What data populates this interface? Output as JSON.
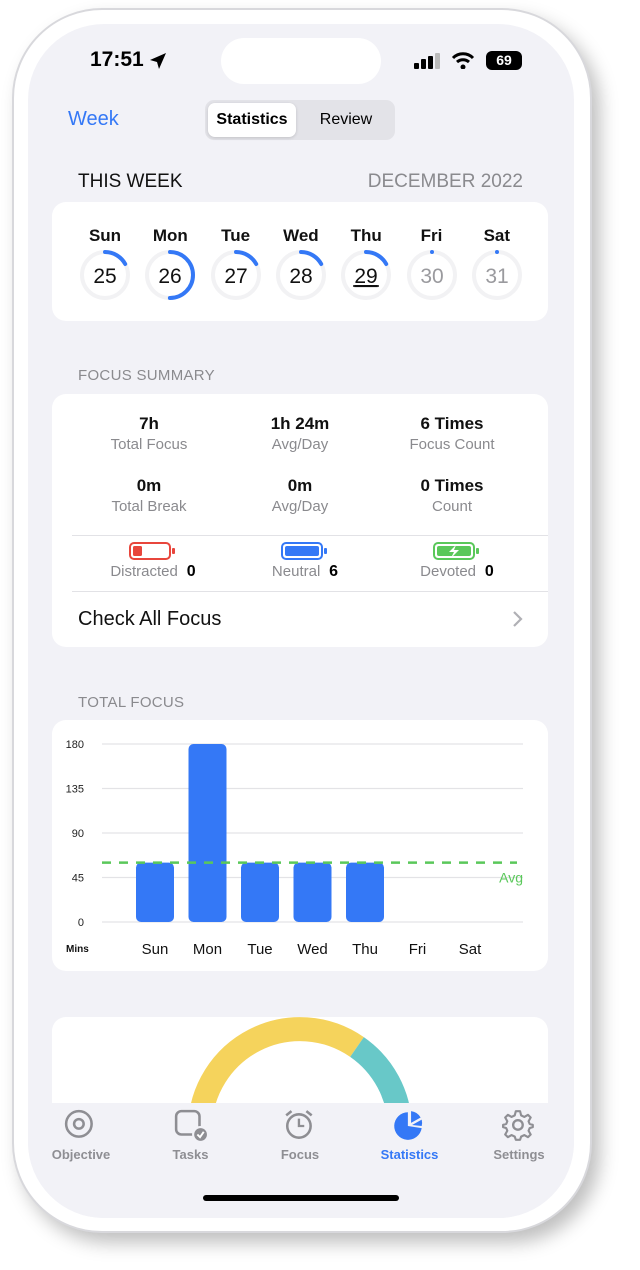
{
  "status_bar": {
    "time": "17:51",
    "battery": "69"
  },
  "header": {
    "back_label": "Week",
    "segments": [
      "Statistics",
      "Review"
    ],
    "selected": "Statistics"
  },
  "this_week": {
    "title": "THIS WEEK",
    "month": "DECEMBER 2022",
    "days": [
      {
        "name": "Sun",
        "date": "25",
        "progress": 0.17
      },
      {
        "name": "Mon",
        "date": "26",
        "progress": 0.5
      },
      {
        "name": "Tue",
        "date": "27",
        "progress": 0.17
      },
      {
        "name": "Wed",
        "date": "28",
        "progress": 0.17
      },
      {
        "name": "Thu",
        "date": "29",
        "progress": 0.17,
        "today": true
      },
      {
        "name": "Fri",
        "date": "30",
        "progress": 0
      },
      {
        "name": "Sat",
        "date": "31",
        "progress": 0
      }
    ]
  },
  "focus_summary": {
    "title": "FOCUS SUMMARY",
    "stats": [
      {
        "value": "7h",
        "label": "Total Focus"
      },
      {
        "value": "1h 24m",
        "label": "Avg/Day"
      },
      {
        "value": "6 Times",
        "label": "Focus Count"
      },
      {
        "value": "0m",
        "label": "Total Break"
      },
      {
        "value": "0m",
        "label": "Avg/Day"
      },
      {
        "value": "0 Times",
        "label": "Count"
      }
    ],
    "states": [
      {
        "label": "Distracted",
        "count": "0",
        "color": "#e8463c"
      },
      {
        "label": "Neutral",
        "count": "6",
        "color": "#3478f6"
      },
      {
        "label": "Devoted",
        "count": "0",
        "color": "#5ac85a"
      }
    ],
    "check_all": "Check All Focus"
  },
  "total_focus": {
    "title": "TOTAL FOCUS"
  },
  "chart_data": {
    "type": "bar",
    "categories": [
      "Sun",
      "Mon",
      "Tue",
      "Wed",
      "Thu",
      "Fri",
      "Sat"
    ],
    "values": [
      60,
      180,
      60,
      60,
      60,
      0,
      0
    ],
    "ylabel": "Mins",
    "yticks": [
      0,
      45,
      90,
      135,
      180
    ],
    "ylim": [
      0,
      180
    ],
    "avg": 60,
    "avg_label": "Avg",
    "grid": true,
    "bar_color": "#3478f6",
    "avg_color": "#5ac85a"
  },
  "tabs": [
    {
      "label": "Objective",
      "icon": "target-icon"
    },
    {
      "label": "Tasks",
      "icon": "task-check-icon"
    },
    {
      "label": "Focus",
      "icon": "alarm-clock-icon"
    },
    {
      "label": "Statistics",
      "icon": "pie-chart-icon",
      "active": true
    },
    {
      "label": "Settings",
      "icon": "gear-icon"
    }
  ],
  "colors": {
    "accent": "#3478f6",
    "background": "#f2f2f7"
  }
}
